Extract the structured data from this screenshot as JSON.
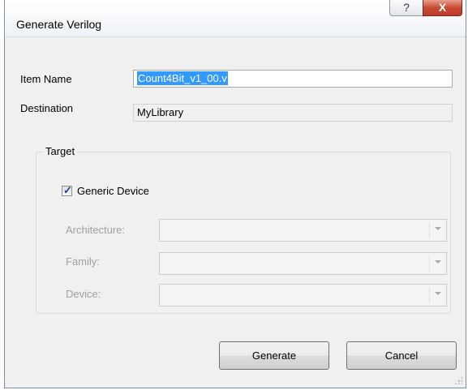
{
  "window": {
    "title": "Generate Verilog",
    "help_glyph": "?",
    "close_glyph": "X"
  },
  "fields": {
    "item_name_label": "Item Name",
    "item_name_value": "Count4Bit_v1_00.v",
    "destination_label": "Destination",
    "destination_value": "MyLibrary"
  },
  "target": {
    "group_title": "Target",
    "generic_device_label": "Generic Device",
    "generic_device_checked": true,
    "check_glyph": "✓",
    "architecture_label": "Architecture:",
    "family_label": "Family:",
    "device_label": "Device:",
    "architecture_value": "",
    "family_value": "",
    "device_value": ""
  },
  "buttons": {
    "generate": "Generate",
    "cancel": "Cancel"
  },
  "icons": {
    "help": "help-icon",
    "close": "close-icon",
    "dropdown": "chevron-down-icon",
    "grip": "resize-grip-icon"
  }
}
